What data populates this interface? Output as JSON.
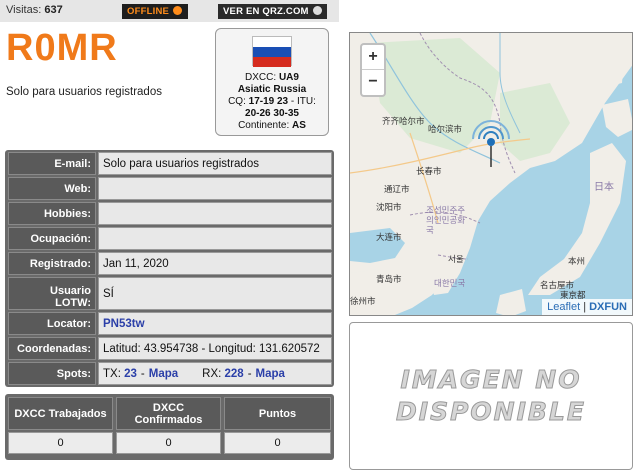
{
  "topbar": {
    "visits_label": "Visitas:",
    "visits_count": "637",
    "offline_label": "OFFLINE",
    "qrz_label": "VER EN QRZ.COM"
  },
  "profile": {
    "callsign": "R0MR",
    "subtitle": "Solo para usuarios registrados"
  },
  "dxcc_card": {
    "dxcc_label": "DXCC:",
    "dxcc_value": "UA9",
    "country": "Asiatic Russia",
    "cq_label": "CQ:",
    "cq_value": "17-19 23",
    "itu_label": "- ITU:",
    "itu_value": "20-26 30-35",
    "continent_label": "Continente:",
    "continent_value": "AS",
    "flag_colors": [
      "#ffffff",
      "#1a4fb5",
      "#d52b1e"
    ]
  },
  "info": {
    "email_label": "E-mail:",
    "email_value": "Solo para usuarios registrados",
    "web_label": "Web:",
    "web_value": "",
    "hobbies_label": "Hobbies:",
    "hobbies_value": "",
    "occupation_label": "Ocupación:",
    "occupation_value": "",
    "registered_label": "Registrado:",
    "registered_value": "Jan 11, 2020",
    "lotw_label_1": "Usuario",
    "lotw_label_2": "LOTW:",
    "lotw_value": "SÍ",
    "locator_label": "Locator:",
    "locator_value": "PN53tw",
    "coords_label": "Coordenadas:",
    "coords_value": "Latitud: 43.954738 - Longitud: 131.620572",
    "spots_label": "Spots:",
    "spots_tx_label": "TX:",
    "spots_tx_count": "23",
    "spots_rx_label": "RX:",
    "spots_rx_count": "228",
    "map_link": "Mapa"
  },
  "stats": {
    "worked_header": "DXCC Trabajados",
    "confirmed_header_1": "DXCC",
    "confirmed_header_2": "Confirmados",
    "points_header": "Puntos",
    "worked_value": "0",
    "confirmed_value": "0",
    "points_value": "0"
  },
  "map": {
    "zoom_in": "+",
    "zoom_out": "−",
    "attrib_leaflet": "Leaflet",
    "attrib_sep": "|",
    "attrib_dxfun": "DXFUN",
    "cities": [
      "齐齐哈尔市",
      "哈尔滨市",
      "长春市",
      "通辽市",
      "沈阳市",
      "조선민주주의인민공화국",
      "大连市",
      "서울",
      "대한민국",
      "青岛市",
      "名古屋市",
      "東京都",
      "日本",
      "本州",
      "徐州市",
      "주의인민"
    ],
    "marker_color": "#1e6fb8"
  },
  "no_image": {
    "line1": "IMAGEN NO",
    "line2": "DISPONIBLE"
  }
}
